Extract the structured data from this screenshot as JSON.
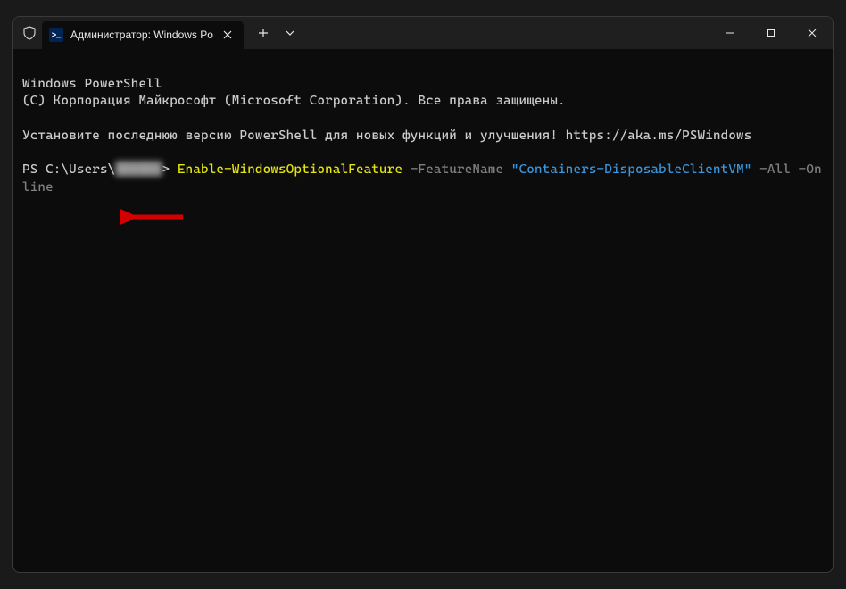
{
  "tab": {
    "title": "Администратор: Windows Po",
    "icon_label": ">_"
  },
  "terminal": {
    "line1": "Windows PowerShell",
    "line2": "(C) Корпорация Майкрософт (Microsoft Corporation). Все права защищены.",
    "line3": "Установите последнюю версию PowerShell для новых функций и улучшения! https://aka.ms/PSWindows",
    "prompt_prefix": "PS C:\\Users\\",
    "prompt_user_blurred": "██████",
    "prompt_suffix": "> ",
    "cmd_cmdlet": "Enable-WindowsOptionalFeature",
    "cmd_param1": " -FeatureName ",
    "cmd_value1": "\"Containers-DisposableClientVM\"",
    "cmd_param2": " -All ",
    "cmd_param3": "-Online"
  }
}
